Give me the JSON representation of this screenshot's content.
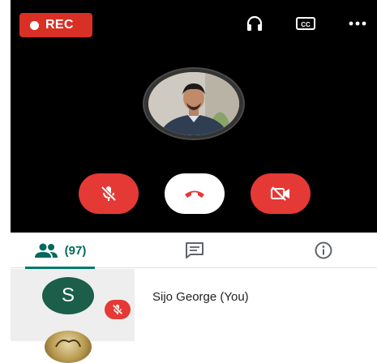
{
  "call_header": {
    "rec_label": "REC",
    "icons": [
      "headphones-icon",
      "closed-captions-icon",
      "more-icon"
    ],
    "accent_color": "#d93025"
  },
  "controls": {
    "icons": [
      "mic-off-icon",
      "hang-up-icon",
      "video-off-icon"
    ],
    "control_red": "#e53935"
  },
  "tabs": {
    "people_count": "(97)",
    "active_tab": "people",
    "accent_color": "#00796b"
  },
  "participants": [
    {
      "initial": "S",
      "name": "Sijo George (You)",
      "muted": true
    }
  ]
}
